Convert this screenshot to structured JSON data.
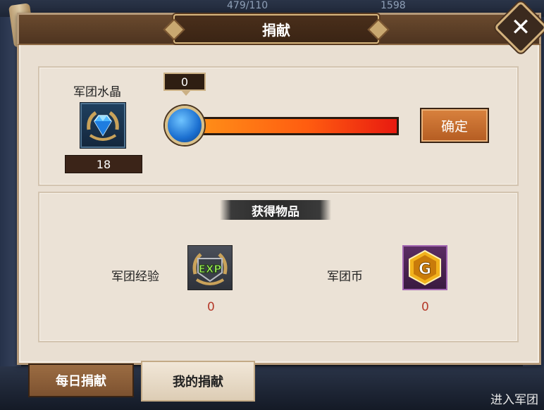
{
  "background": {
    "top_stat_1": "479/110",
    "top_stat_2": "1598",
    "bottom_right_text": "进入军团"
  },
  "dialog": {
    "title": "捐献",
    "close_label": "✕"
  },
  "donation": {
    "item_label": "军团水晶",
    "item_count": "18",
    "slider_value": "0",
    "slider_level": 0,
    "confirm_label": "确定"
  },
  "rewards": {
    "heading": "获得物品",
    "items": [
      {
        "label": "军团经验",
        "value": "0",
        "icon": "exp-icon",
        "icon_text": "EXP"
      },
      {
        "label": "军团币",
        "value": "0",
        "icon": "g-coin-icon",
        "icon_text": "G"
      }
    ]
  },
  "tabs": [
    {
      "label": "每日捐献",
      "active": false
    },
    {
      "label": "我的捐献",
      "active": true
    }
  ],
  "colors": {
    "accent": "#b45c22",
    "reward_value": "#b53a2a",
    "slider_knob": "#1b6fd0"
  }
}
